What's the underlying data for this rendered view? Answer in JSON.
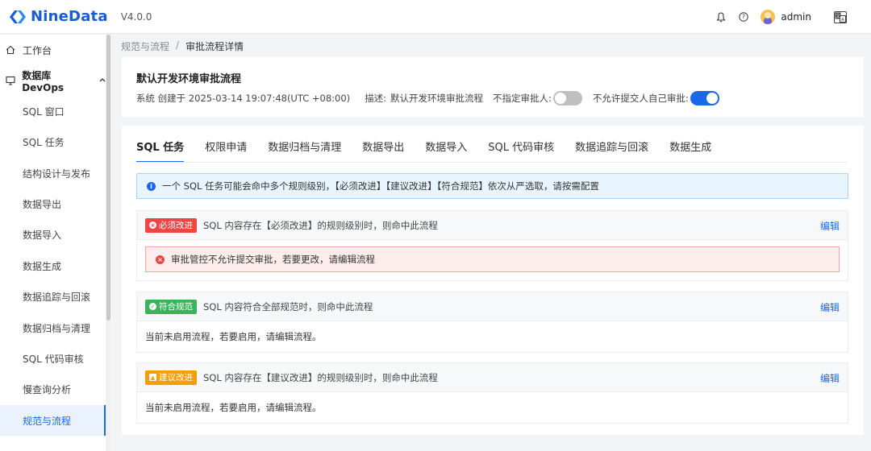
{
  "header": {
    "app_name": "NineData",
    "version": "V4.0.0",
    "user_name": "admin",
    "icons": [
      "bell-icon",
      "help-icon",
      "language-icon"
    ]
  },
  "sidebar": {
    "items": [
      {
        "label": "工作台",
        "icon": "home-icon"
      },
      {
        "label": "数据库 DevOps",
        "icon": "monitor-icon",
        "expanded": true
      },
      {
        "label": "SQL 窗口"
      },
      {
        "label": "SQL 任务"
      },
      {
        "label": "结构设计与发布"
      },
      {
        "label": "数据导出"
      },
      {
        "label": "数据导入"
      },
      {
        "label": "数据生成"
      },
      {
        "label": "数据追踪与回滚"
      },
      {
        "label": "数据归档与清理"
      },
      {
        "label": "SQL 代码审核"
      },
      {
        "label": "慢查询分析"
      },
      {
        "label": "规范与流程",
        "active": true
      }
    ]
  },
  "breadcrumb": {
    "parent": "规范与流程",
    "separator": "/",
    "current": "审批流程详情"
  },
  "flow": {
    "title": "默认开发环境审批流程",
    "created": "系统 创建于 2025-03-14 19:07:48(UTC +08:00)",
    "desc_label": "描述:",
    "desc_value": "默认开发环境审批流程",
    "no_approver_label": "不指定审批人:",
    "no_approver_on": false,
    "no_self_approve_label": "不允许提交人自己审批:",
    "no_self_approve_on": true
  },
  "tabs": [
    "SQL 任务",
    "权限申请",
    "数据归档与清理",
    "数据导出",
    "数据导入",
    "SQL 代码审核",
    "数据追踪与回滚",
    "数据生成"
  ],
  "active_tab": "SQL 任务",
  "info_alert": "一个 SQL 任务可能会命中多个规则级别，【必须改进】【建议改进】【符合规范】依次从严选取，请按需配置",
  "rules": [
    {
      "badge": "必须改进",
      "badge_color": "#ef4444",
      "description": "SQL 内容存在【必须改进】的规则级别时，则命中此流程",
      "edit": "编辑",
      "error": "审批管控不允许提交审批，若要更改，请编辑流程"
    },
    {
      "badge": "符合规范",
      "badge_color": "#3bb35b",
      "description": "SQL 内容符合全部规范时，则命中此流程",
      "edit": "编辑",
      "body": "当前未启用流程，若要启用，请编辑流程。"
    },
    {
      "badge": "建议改进",
      "badge_color": "#f59e0b",
      "description": "SQL 内容存在【建议改进】的规则级别时，则命中此流程",
      "edit": "编辑",
      "body": "当前未启用流程，若要启用，请编辑流程。"
    }
  ],
  "colors": {
    "accent": "#1a68e8",
    "danger": "#ef4444",
    "success": "#3bb35b",
    "warning": "#f59e0b"
  }
}
